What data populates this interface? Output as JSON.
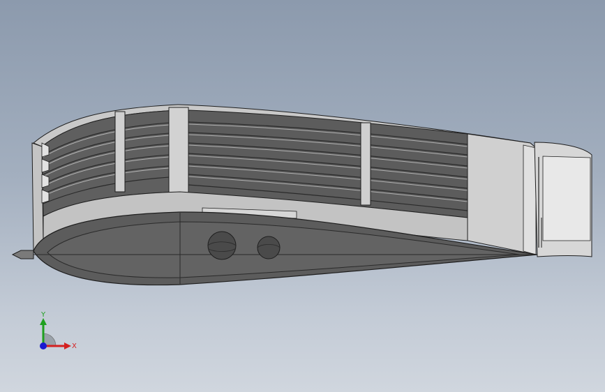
{
  "viewport": {
    "background_top": "#8c9aad",
    "background_bottom": "#d0d6de"
  },
  "model": {
    "name_icon": "airfoil-wing-section-model",
    "colors": {
      "outline": "#1e1e1e",
      "light_face": "#c8c8c8",
      "mid_face": "#9a9a9a",
      "dark_face": "#5f5f5f",
      "rib_dark": "#3c3c3c"
    }
  },
  "triad": {
    "x_label": "X",
    "y_label": "Y",
    "x_color": "#d42020",
    "y_color": "#1fa01f",
    "z_color": "#1a1ad0"
  }
}
